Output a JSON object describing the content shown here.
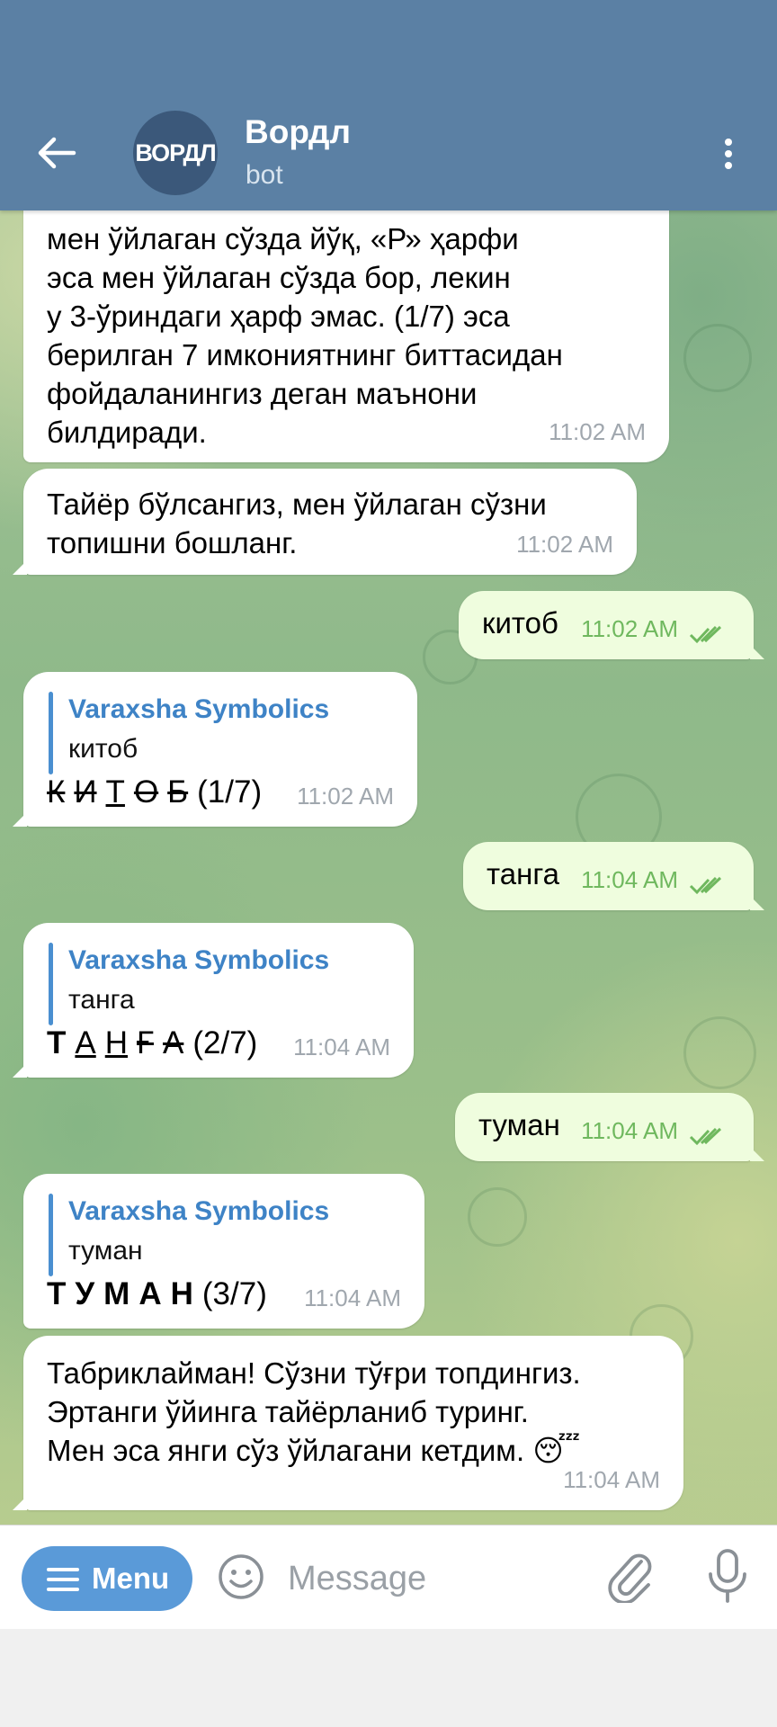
{
  "header": {
    "title": "Вордл",
    "subtitle": "bot",
    "avatar_text": "ВОРДЛ"
  },
  "messages": {
    "m1": {
      "lines": "мен ўйлаган сўзда йўқ, «Р» ҳарфи\nэса мен ўйлаган сўзда бор, лекин\nу 3-ўриндаги ҳарф эмас. (1/7) эса\nберилган 7 имкониятнинг биттасидан\nфойдаланингиз деган маънони\nбилдиради.",
      "time": "11:02 AM"
    },
    "m2": {
      "lines": "Тайёр бўлсангиз, мен ўйлаган сўзни\nтопишни бошланг.",
      "time": "11:02 AM"
    },
    "m3": {
      "text": "китоб",
      "time": "11:02 AM"
    },
    "m4": {
      "reply_name": "Varaxsha Symbolics",
      "reply_text": "китоб",
      "letters": [
        "К",
        "И",
        "Т",
        "О",
        "Б"
      ],
      "count": "(1/7)",
      "time": "11:02 AM"
    },
    "m5": {
      "text": "танга",
      "time": "11:04 AM"
    },
    "m6": {
      "reply_name": "Varaxsha Symbolics",
      "reply_text": "танга",
      "letters": [
        "Т",
        "А",
        "Н",
        "Ғ",
        "А"
      ],
      "count": "(2/7)",
      "time": "11:04 AM"
    },
    "m7": {
      "text": "туман",
      "time": "11:04 AM"
    },
    "m8": {
      "reply_name": "Varaxsha Symbolics",
      "reply_text": "туман",
      "letters": [
        "Т",
        "У",
        "М",
        "А",
        "Н"
      ],
      "count": "(3/7)",
      "time": "11:04 AM"
    },
    "m9": {
      "lines": "Табриклайман! Сўзни тўғри топдингиз.\nЭртанги ўйинга тайёрланиб туринг.\nМен эса янги сўз ўйлагани кетдим. 😴",
      "time": "11:04 AM"
    }
  },
  "input": {
    "menu_label": "Menu",
    "placeholder": "Message"
  },
  "colors": {
    "header": "#5b80a4",
    "outgoing_bubble": "#effdde",
    "link_accent": "#3e83c6",
    "menu_button": "#5a9ad8"
  }
}
